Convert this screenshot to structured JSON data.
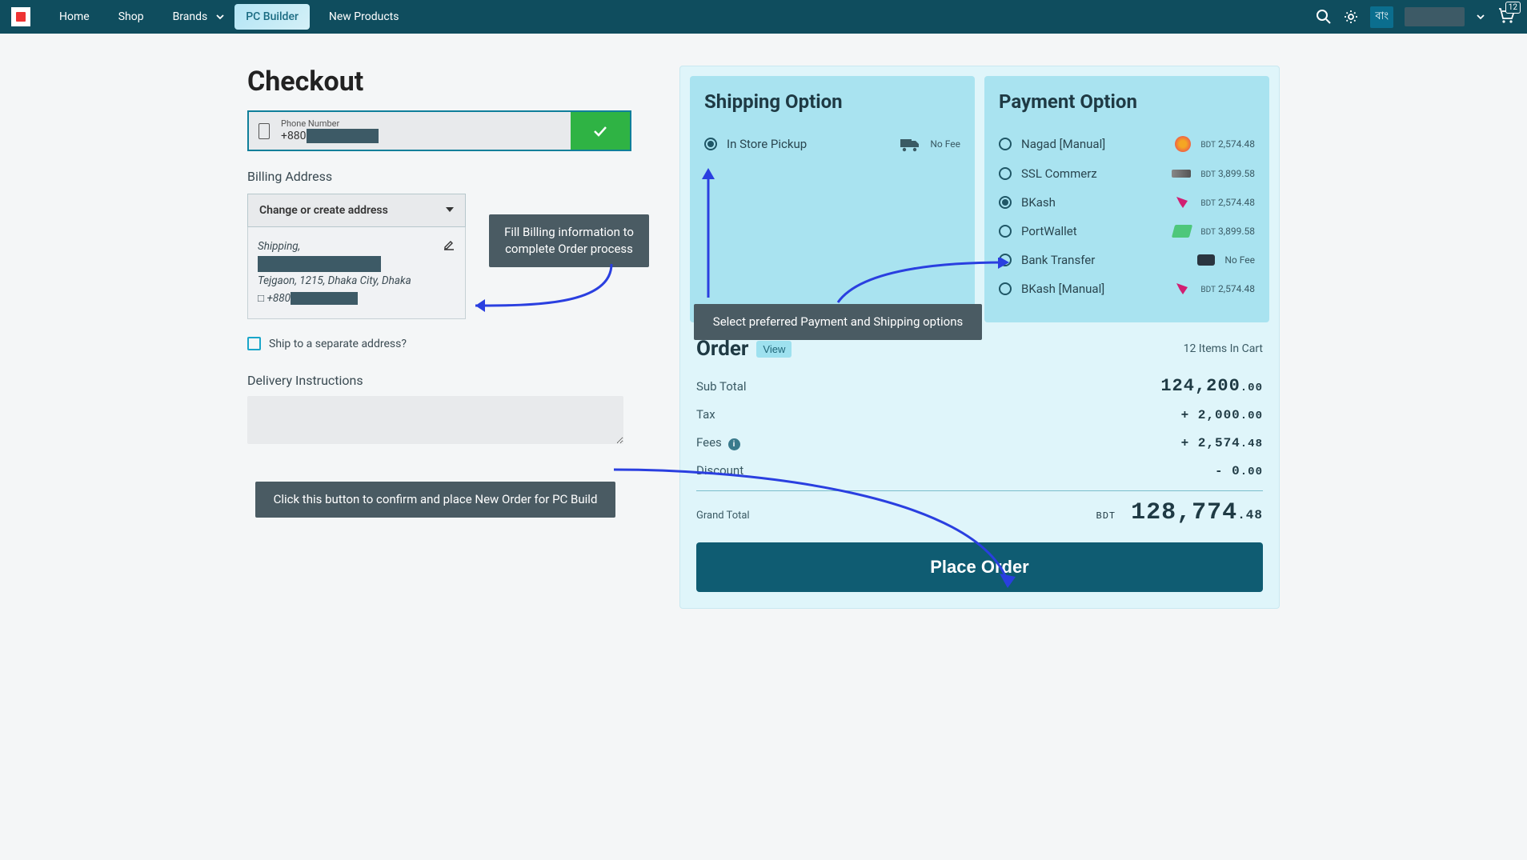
{
  "nav": {
    "home": "Home",
    "shop": "Shop",
    "brands": "Brands",
    "pc_builder": "PC Builder",
    "new_products": "New Products",
    "lang": "বাং",
    "cart_badge": "12"
  },
  "page_title": "Checkout",
  "phone": {
    "label": "Phone Number",
    "prefix": "+880"
  },
  "billing": {
    "heading": "Billing Address",
    "select_label": "Change or create address",
    "card_type": "Shipping,",
    "line2": "Tejgaon, 1215, Dhaka City, Dhaka",
    "phone_prefix": "+880"
  },
  "ship_separate": "Ship to a separate address?",
  "delivery_label": "Delivery Instructions",
  "tooltips": {
    "billing": "Fill Billing information to complete Order process",
    "options": "Select preferred Payment and Shipping options",
    "place": "Click this button to confirm and place New Order for PC Build"
  },
  "shipping": {
    "heading": "Shipping Option",
    "opt1": "In Store Pickup",
    "opt1_fee": "No Fee"
  },
  "payment": {
    "heading": "Payment Option",
    "opt1": "Nagad [Manual]",
    "p1": "2,574.48",
    "opt2": "SSL Commerz",
    "p2": "3,899.58",
    "opt3": "BKash",
    "p3": "2,574.48",
    "opt4": "PortWallet",
    "p4": "3,899.58",
    "opt5": "Bank Transfer",
    "p5": "No Fee",
    "opt6": "BKash [Manual]",
    "p6": "2,574.48",
    "currency": "BDT"
  },
  "order": {
    "heading": "Order",
    "view": "View",
    "count": "12 Items In Cart",
    "subtotal_l": "Sub Total",
    "subtotal_v": "124,200",
    "subtotal_d": ".00",
    "tax_l": "Tax",
    "tax_v": "+ 2,000",
    "tax_d": ".00",
    "fees_l": "Fees",
    "fees_v": "+ 2,574",
    "fees_d": ".48",
    "disc_l": "Discount",
    "disc_v": "- 0",
    "disc_d": ".00",
    "grand_l": "Grand Total",
    "grand_v": "128,774",
    "grand_d": ".48",
    "currency": "BDT",
    "place_btn": "Place Order"
  }
}
